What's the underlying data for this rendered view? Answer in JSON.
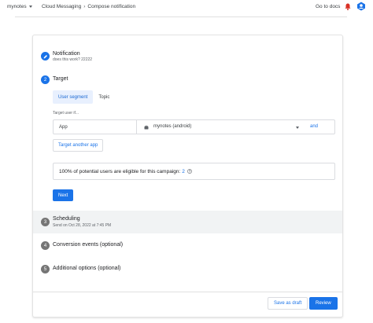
{
  "topbar": {
    "project": "mynotes",
    "breadcrumb": [
      "Cloud Messaging",
      "Compose notification"
    ],
    "separator": "›",
    "docs_link": "Go to docs"
  },
  "steps": {
    "notification": {
      "title": "Notification",
      "subtitle": "does this work? 22222"
    },
    "target": {
      "number": "2",
      "title": "Target"
    },
    "scheduling": {
      "number": "3",
      "title": "Scheduling",
      "subtitle": "Send on Oct 28, 2022 at 7:45 PM"
    },
    "conversion": {
      "number": "4",
      "title": "Conversion events (optional)"
    },
    "additional": {
      "number": "5",
      "title": "Additional options (optional)"
    }
  },
  "target": {
    "tabs": [
      {
        "label": "User segment",
        "active": true
      },
      {
        "label": "Topic",
        "active": false
      }
    ],
    "target_user_label": "Target user if...",
    "row": {
      "field": "App",
      "value": "mynotes (android)",
      "and": "and"
    },
    "another_app_label": "Target another app",
    "eligibility": {
      "text": "100% of potential users are eligible for this campaign:",
      "count": "2"
    },
    "next_label": "Next"
  },
  "footer": {
    "save_draft": "Save as draft",
    "review": "Review"
  },
  "colors": {
    "accent": "#1a73e8",
    "inactive_step": "#757575",
    "highlight": "#f1f3f4",
    "bell": "#d93025"
  },
  "icons": {
    "project_caret": "chevron-down-icon",
    "bell": "bell-icon",
    "avatar": "avatar",
    "notification_done": "pencil-icon",
    "android": "android-icon",
    "help": "help-icon",
    "dropdown": "chevron-down-icon"
  }
}
